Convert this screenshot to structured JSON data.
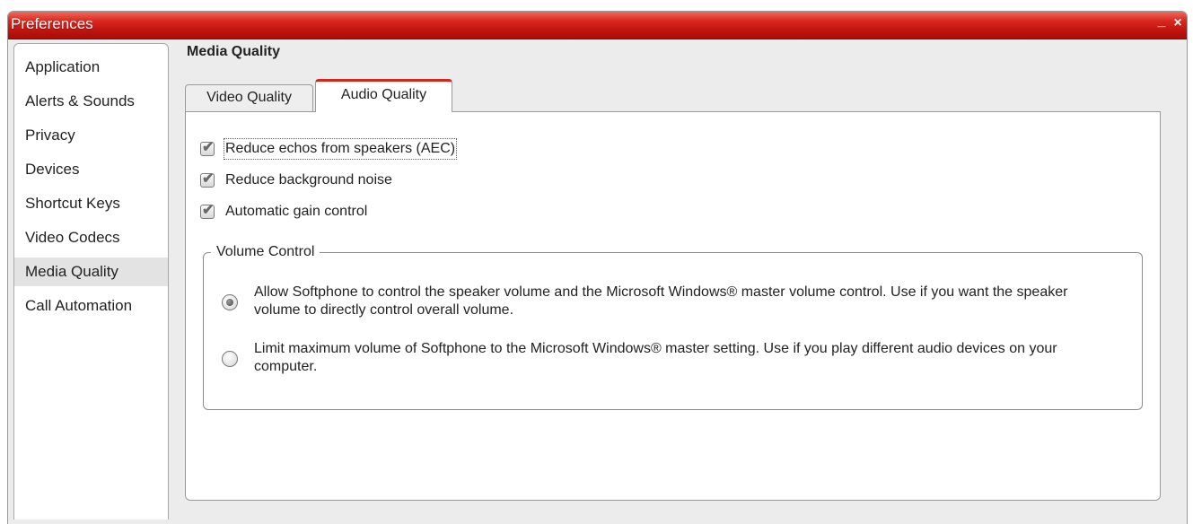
{
  "window": {
    "title": "Preferences",
    "minimize_label": "_",
    "close_label": "×"
  },
  "sidebar": {
    "items": [
      {
        "label": "Application"
      },
      {
        "label": "Alerts & Sounds"
      },
      {
        "label": "Privacy"
      },
      {
        "label": "Devices"
      },
      {
        "label": "Shortcut Keys"
      },
      {
        "label": "Video Codecs"
      },
      {
        "label": "Media Quality",
        "selected": true
      },
      {
        "label": "Call Automation"
      }
    ]
  },
  "main": {
    "section_title": "Media Quality",
    "tabs": [
      {
        "label": "Video Quality",
        "active": false
      },
      {
        "label": "Audio Quality",
        "active": true
      }
    ],
    "checkboxes": [
      {
        "label": "Reduce echos from speakers (AEC)",
        "checked": true
      },
      {
        "label": "Reduce background noise",
        "checked": true
      },
      {
        "label": "Automatic gain control",
        "checked": true
      }
    ],
    "volume_control": {
      "legend": "Volume Control",
      "options": [
        {
          "label": "Allow Softphone to control the speaker volume and the Microsoft Windows® master volume control. Use if you want the speaker volume to directly control overall volume.",
          "selected": true
        },
        {
          "label": "Limit maximum volume of Softphone to the Microsoft Windows® master setting. Use if you play different audio devices on your computer.",
          "selected": false
        }
      ]
    }
  },
  "colors": {
    "titlebar": "#c0140f",
    "active_tab_accent": "#d4261c",
    "selected_nav": "#e3e3e3"
  }
}
